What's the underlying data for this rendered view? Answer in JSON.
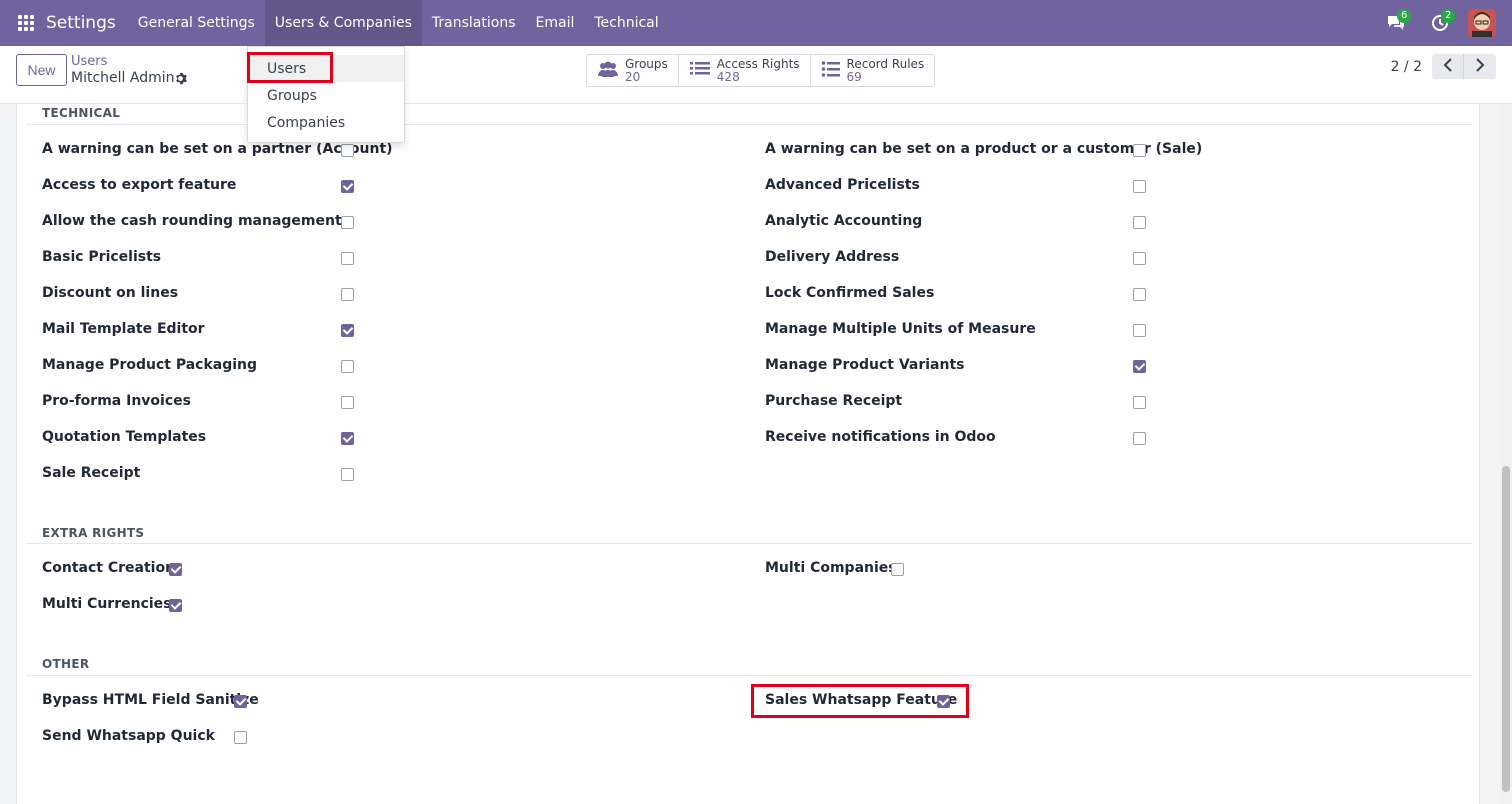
{
  "navbar": {
    "app_title": "Settings",
    "menu": [
      "General Settings",
      "Users & Companies",
      "Translations",
      "Email",
      "Technical"
    ],
    "messages_count": "6",
    "activities_count": "2"
  },
  "control": {
    "new_label": "New",
    "breadcrumb_parent": "Users",
    "breadcrumb_current": "Mitchell Admin",
    "stats": [
      {
        "label": "Groups",
        "value": "20"
      },
      {
        "label": "Access Rights",
        "value": "428"
      },
      {
        "label": "Record Rules",
        "value": "69"
      }
    ],
    "pager": "2 / 2"
  },
  "dropdown": {
    "items": [
      "Users",
      "Groups",
      "Companies"
    ]
  },
  "sections": {
    "technical": {
      "title": "TECHNICAL",
      "left": [
        {
          "label": "A warning can be set on a partner (Account)",
          "checked": false
        },
        {
          "label": "Access to export feature",
          "checked": true
        },
        {
          "label": "Allow the cash rounding management",
          "checked": false
        },
        {
          "label": "Basic Pricelists",
          "checked": false
        },
        {
          "label": "Discount on lines",
          "checked": false
        },
        {
          "label": "Mail Template Editor",
          "checked": true
        },
        {
          "label": "Manage Product Packaging",
          "checked": false
        },
        {
          "label": "Pro-forma Invoices",
          "checked": false
        },
        {
          "label": "Quotation Templates",
          "checked": true
        },
        {
          "label": "Sale Receipt",
          "checked": false
        }
      ],
      "right": [
        {
          "label": "A warning can be set on a product or a customer (Sale)",
          "checked": false
        },
        {
          "label": "Advanced Pricelists",
          "checked": false
        },
        {
          "label": "Analytic Accounting",
          "checked": false
        },
        {
          "label": "Delivery Address",
          "checked": false
        },
        {
          "label": "Lock Confirmed Sales",
          "checked": false
        },
        {
          "label": "Manage Multiple Units of Measure",
          "checked": false
        },
        {
          "label": "Manage Product Variants",
          "checked": true
        },
        {
          "label": "Purchase Receipt",
          "checked": false
        },
        {
          "label": "Receive notifications in Odoo",
          "checked": false
        }
      ]
    },
    "extra_rights": {
      "title": "EXTRA RIGHTS",
      "left": [
        {
          "label": "Contact Creation",
          "checked": true
        },
        {
          "label": "Multi Currencies",
          "checked": true
        }
      ],
      "right": [
        {
          "label": "Multi Companies",
          "checked": false
        }
      ]
    },
    "other": {
      "title": "OTHER",
      "left": [
        {
          "label": "Bypass HTML Field Sanitize",
          "checked": true
        },
        {
          "label": "Send Whatsapp Quick",
          "checked": false
        }
      ],
      "right": [
        {
          "label": "Sales Whatsapp Feature",
          "checked": true
        }
      ]
    }
  },
  "colors": {
    "brand": "#71639e",
    "highlight": "#e0001b",
    "badge": "#28a745"
  }
}
